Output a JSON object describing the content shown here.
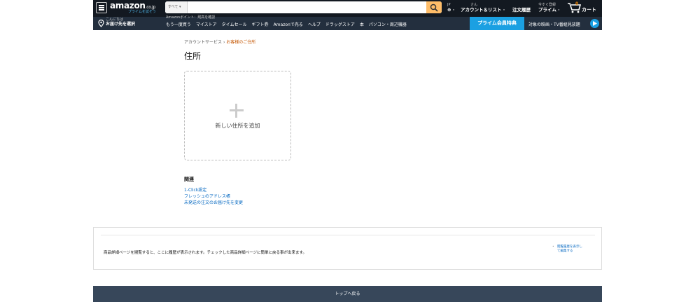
{
  "header": {
    "logo": "amazon",
    "logo_tld": ".co.jp",
    "logo_sub": "プライムを試そう",
    "search_category": "すべて ▾",
    "search_placeholder": "",
    "lang_top": "JP",
    "lang_bottom": "⊕ ·",
    "account_top": "さん",
    "account_bottom": "アカウント＆リスト ·",
    "orders": "注文履歴",
    "prime_top": "今すぐ登録",
    "prime_bottom": "プライム ·",
    "cart_count": "0",
    "cart_label": "カート",
    "location_top": "こんにちは",
    "location_bottom": "お届け先を選択",
    "points": "Amazonポイント：残高を確認",
    "links": [
      "もう一度買う",
      "マイストア",
      "タイムセール",
      "ギフト券",
      "Amazonで売る",
      "ヘルプ",
      "ドラッグストア",
      "本",
      "パソコン・周辺機器"
    ],
    "prime_banner": "プライム会員特典",
    "video_promo": "対象の映画・TV番組見放題"
  },
  "breadcrumb": {
    "parent": "アカウントサービス",
    "separator": "›",
    "current": "お客様のご住所"
  },
  "page_title": "住所",
  "add_card": {
    "label": "新しい住所を追加"
  },
  "related": {
    "heading": "関連",
    "links": [
      "1-Click設定",
      "フレッシュのアドレス帳",
      "未発送の注文のお届け先を変更"
    ]
  },
  "history": {
    "text": "商品詳細ページを閲覧すると、ここに履歴が表示されます。チェックした商品詳細ページに簡単に戻る事が出来ます。",
    "link_line1": "閲覧履歴を表示し",
    "link_line2": "て編集する"
  },
  "back_to_top": "トップへ戻る",
  "colors": {
    "nav_dark": "#131921",
    "nav_secondary": "#232f3e",
    "search_button": "#febd69",
    "prime_blue": "#1ba0e2",
    "link": "#0066c0",
    "breadcrumb_current": "#c45500",
    "footer": "#37475a"
  }
}
